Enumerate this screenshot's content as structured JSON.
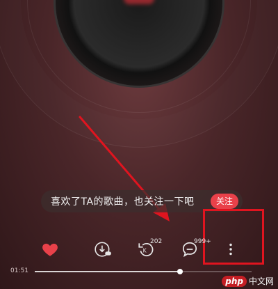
{
  "prompt": {
    "text": "喜欢了TA的歌曲，也关注一下吧",
    "follow_label": "关注"
  },
  "actions": {
    "like": {
      "icon": "heart-icon"
    },
    "download": {
      "icon": "download-icon",
      "badge": ""
    },
    "remix": {
      "icon": "remix-icon",
      "badge": "202"
    },
    "comment": {
      "icon": "comment-icon",
      "badge": "999+"
    },
    "more": {
      "icon": "more-vertical-icon"
    }
  },
  "player": {
    "elapsed": "01:51",
    "progress": 0.67
  },
  "watermark": {
    "logo": "php",
    "site": "中文网"
  },
  "colors": {
    "accent": "#e9414a",
    "annotation": "#e0141f"
  }
}
